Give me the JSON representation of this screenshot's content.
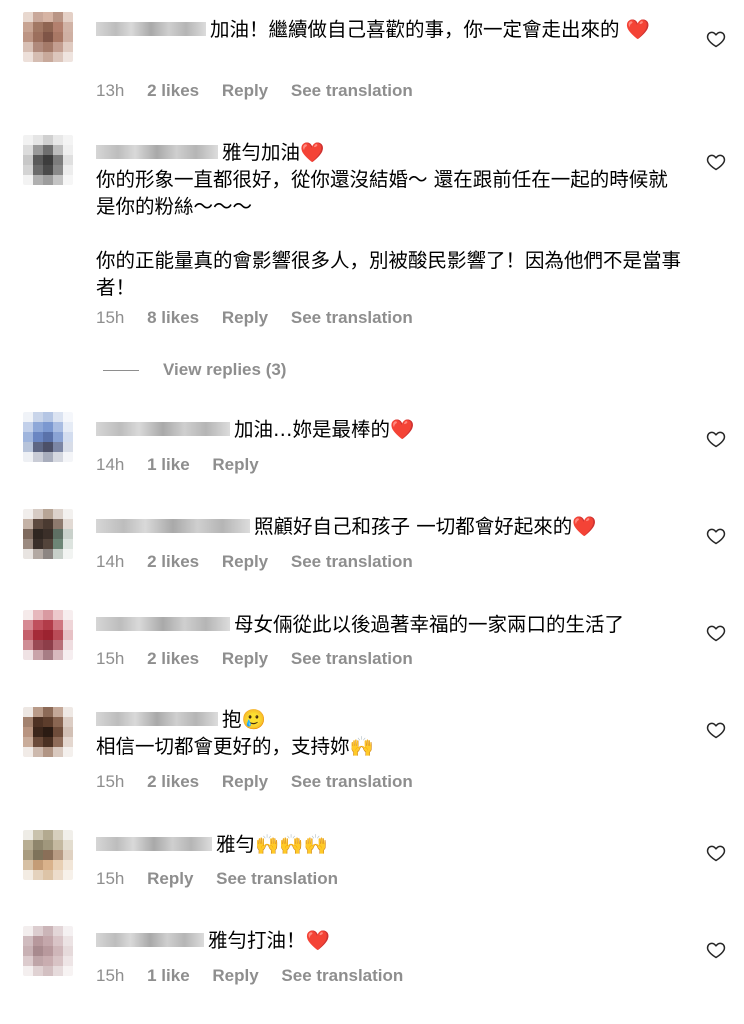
{
  "comments": [
    {
      "text": "加油！繼續做自己喜歡的事，你一定會走出來的 ❤️",
      "time": "13h",
      "likes": "2 likes",
      "reply": "Reply",
      "translation": "See translation",
      "avatar_colors": [
        "#e8d8cf",
        "#c9a89a",
        "#d6b4a4",
        "#b99585",
        "#e4d0c6",
        "#c8a493",
        "#a27864",
        "#8f6552",
        "#b3806e",
        "#d1b3a6",
        "#bd9584",
        "#9c6f5d",
        "#7f5547",
        "#a97865",
        "#cfb0a3",
        "#d8c0b5",
        "#b08a7c",
        "#a47a69",
        "#c39e90",
        "#e0cbc1",
        "#ede0da",
        "#d5bdb2",
        "#c8a99b",
        "#dcc6bc",
        "#efe4df"
      ]
    },
    {
      "text": "雅勻加油❤️\n你的形象一直都很好，從你還沒結婚～ 還在跟前任在一起的時候就是你的粉絲～～～\n\n你的正能量真的會影響很多人，別被酸民影響了！因為他們不是當事者！",
      "time": "15h",
      "likes": "8 likes",
      "reply": "Reply",
      "translation": "See translation",
      "avatar_colors": [
        "#f2f2f2",
        "#e5e5e5",
        "#d0d0d0",
        "#e8e8e8",
        "#f4f4f4",
        "#dcdcdc",
        "#9a9a9a",
        "#6f6f6f",
        "#bdbdbd",
        "#efefef",
        "#c8c8c8",
        "#5a5a5a",
        "#3d3d3d",
        "#7c7c7c",
        "#e0e0e0",
        "#d4d4d4",
        "#6b6b6b",
        "#4a4a4a",
        "#8a8a8a",
        "#ededed",
        "#f3f3f3",
        "#b0b0b0",
        "#9d9d9d",
        "#c4c4c4",
        "#f6f6f6"
      ]
    },
    {
      "text": "加油…妳是最棒的❤️",
      "time": "14h",
      "likes": "1 like",
      "reply": "Reply",
      "translation": "",
      "avatar_colors": [
        "#f0f3f8",
        "#c9d5ea",
        "#b5c6e4",
        "#dbe3f1",
        "#f5f7fb",
        "#c2d0ea",
        "#8ea8d8",
        "#7b98d0",
        "#a9bde2",
        "#e6ecf6",
        "#9fb5dd",
        "#6a86c2",
        "#5a72aa",
        "#8aa3d4",
        "#d3ddef",
        "#b8c4da",
        "#5e6784",
        "#4c5068",
        "#7c86a4",
        "#d8dde8",
        "#eef0f4",
        "#c9ccd6",
        "#a8adbc",
        "#d5d8e0",
        "#f4f5f8"
      ]
    },
    {
      "text": "照顧好自己和孩子 一切都會好起來的❤️",
      "time": "14h",
      "likes": "2 likes",
      "reply": "Reply",
      "translation": "See translation",
      "avatar_colors": [
        "#f1eeec",
        "#d6cbc4",
        "#b7a596",
        "#dcd2cb",
        "#f3f1ef",
        "#c4b2a6",
        "#5d4a3f",
        "#4a3a31",
        "#8d7a6e",
        "#e2dad4",
        "#7e6a5e",
        "#2f2621",
        "#3b2f29",
        "#5e6f63",
        "#c9d1cb",
        "#9b8a80",
        "#3a2f2a",
        "#53443b",
        "#6d8676",
        "#dde4df",
        "#e8e4e1",
        "#b3a9a3",
        "#8c8582",
        "#c7cfc9",
        "#f2f4f2"
      ]
    },
    {
      "text": "母女倆從此以後過著幸福的一家兩口的生活了",
      "time": "15h",
      "likes": "2 likes",
      "reply": "Reply",
      "translation": "See translation",
      "avatar_colors": [
        "#f5eaea",
        "#e6b8bc",
        "#d99aa1",
        "#ecc9cc",
        "#f7eeef",
        "#d68a93",
        "#c0505d",
        "#b23c49",
        "#cf7680",
        "#efd5d8",
        "#c5606b",
        "#a52b38",
        "#9c2330",
        "#b94c57",
        "#e7c1c5",
        "#cf8d95",
        "#9a4a55",
        "#8d3e49",
        "#b86f78",
        "#efdde0",
        "#efe2e4",
        "#c9a3a9",
        "#a77d85",
        "#d7b9be",
        "#f6eef0"
      ]
    },
    {
      "text": "抱🥲\n相信一切都會更好的，支持妳🙌",
      "time": "15h",
      "likes": "2 likes",
      "reply": "Reply",
      "translation": "See translation",
      "avatar_colors": [
        "#ede7e3",
        "#b89a88",
        "#8c6a57",
        "#c4a898",
        "#efe9e5",
        "#a3826f",
        "#4e3224",
        "#5d3d2c",
        "#8a6652",
        "#dccdc4",
        "#b89480",
        "#3c261b",
        "#2b1b13",
        "#6e4c3a",
        "#d2c0b5",
        "#c9ac9a",
        "#6a4a39",
        "#4a3022",
        "#8f6c59",
        "#e4d7cf",
        "#f1ebe7",
        "#cdb9ad",
        "#b19584",
        "#d9c9bf",
        "#f4f0ed"
      ]
    },
    {
      "text": "雅勻🙌🙌🙌",
      "time": "15h",
      "likes": "",
      "reply": "Reply",
      "translation": "See translation",
      "avatar_colors": [
        "#eeece6",
        "#c9c2ad",
        "#b3aa90",
        "#d6cfbd",
        "#f1efea",
        "#b8ae93",
        "#8f866c",
        "#a0977c",
        "#c4b9a0",
        "#e3ddcf",
        "#a99c80",
        "#7e735a",
        "#8a6f58",
        "#b79b83",
        "#e0d2c2",
        "#d6c0a4",
        "#c49c76",
        "#d9b28b",
        "#e8cfb3",
        "#f2e6d8",
        "#f3ece3",
        "#e4d2bd",
        "#ddc4a7",
        "#ecdccb",
        "#f7f1ea"
      ]
    },
    {
      "text": "雅勻打油！❤️",
      "time": "15h",
      "likes": "1 like",
      "reply": "Reply",
      "translation": "See translation",
      "avatar_colors": [
        "#f3eeee",
        "#dccdcf",
        "#cbb5b8",
        "#e3d6d8",
        "#f5f1f2",
        "#d0bcbf",
        "#b7989c",
        "#c4a7ab",
        "#d9c4c7",
        "#ece3e4",
        "#c8b1b4",
        "#a88a8e",
        "#b8999d",
        "#cfb6b9",
        "#e6dadb",
        "#dccbcd",
        "#bfa5a8",
        "#c9adb0",
        "#d8c3c5",
        "#eee5e6",
        "#f4efef",
        "#e0d2d3",
        "#d3c0c2",
        "#e6dbdc",
        "#f7f3f3"
      ]
    }
  ],
  "view_replies": "View replies (3)",
  "colors": {
    "meta": "#8e8e8e",
    "heart": "#ed1c24",
    "text": "#000000"
  }
}
